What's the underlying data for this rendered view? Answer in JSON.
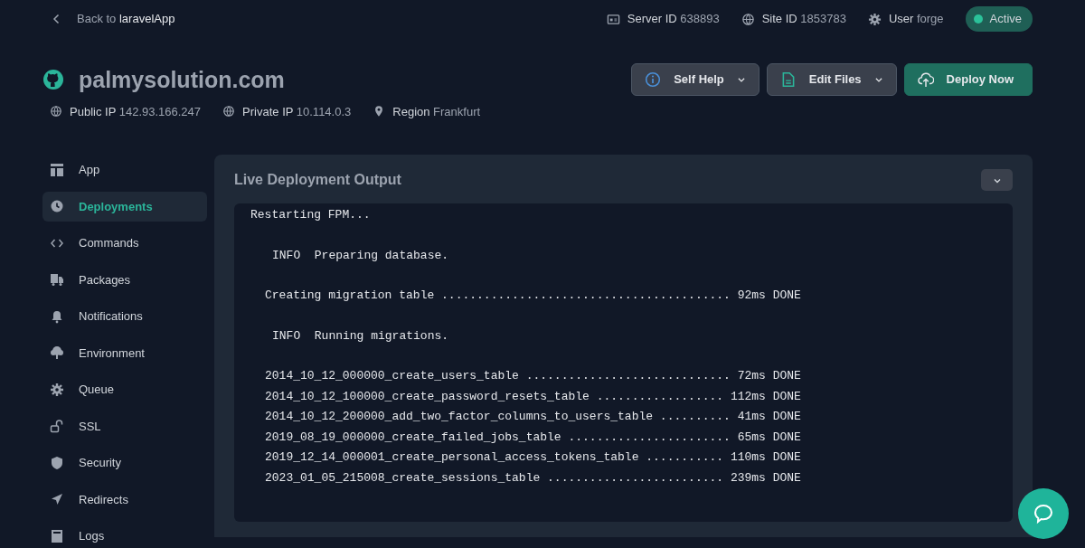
{
  "back": {
    "label": "Back to",
    "app": "laravelApp"
  },
  "meta": [
    {
      "kind": "server",
      "label": "Server ID",
      "value": "638893"
    },
    {
      "kind": "globe",
      "label": "Site ID",
      "value": "1853783"
    },
    {
      "kind": "gear",
      "label": "User",
      "value": "forge"
    }
  ],
  "status": {
    "label": "Active"
  },
  "site": {
    "title": "palmysolution.com"
  },
  "info": [
    {
      "kind": "globe",
      "label": "Public IP",
      "value": "142.93.166.247"
    },
    {
      "kind": "globe",
      "label": "Private IP",
      "value": "10.114.0.3"
    },
    {
      "kind": "pin",
      "label": "Region",
      "value": "Frankfurt"
    }
  ],
  "actions": [
    {
      "kind": "help",
      "label": "Self Help",
      "dropdown": true
    },
    {
      "kind": "files",
      "label": "Edit Files",
      "dropdown": true
    },
    {
      "kind": "deploy",
      "label": "Deploy Now",
      "dropdown": false
    }
  ],
  "sidebar": {
    "items": [
      {
        "kind": "layout",
        "label": "App",
        "selected": false
      },
      {
        "kind": "clock",
        "label": "Deployments",
        "selected": true
      },
      {
        "kind": "code",
        "label": "Commands",
        "selected": false
      },
      {
        "kind": "truck",
        "label": "Packages",
        "selected": false
      },
      {
        "kind": "bell",
        "label": "Notifications",
        "selected": false
      },
      {
        "kind": "tree",
        "label": "Environment",
        "selected": false
      },
      {
        "kind": "gear",
        "label": "Queue",
        "selected": false
      },
      {
        "kind": "lock",
        "label": "SSL",
        "selected": false
      },
      {
        "kind": "shield",
        "label": "Security",
        "selected": false
      },
      {
        "kind": "arrow",
        "label": "Redirects",
        "selected": false
      },
      {
        "kind": "logs",
        "label": "Logs",
        "selected": false
      }
    ]
  },
  "panel": {
    "title": "Live Deployment Output"
  },
  "output": {
    "blocks": [
      {
        "kind": "plain",
        "lines": [
          "Restarting FPM..."
        ]
      },
      {
        "kind": "info",
        "lines": [
          "INFO  Preparing database."
        ]
      },
      {
        "kind": "task",
        "lines": [
          "Creating migration table ......................................... 92ms DONE"
        ]
      },
      {
        "kind": "info",
        "lines": [
          "INFO  Running migrations."
        ]
      },
      {
        "kind": "task",
        "lines": [
          "2014_10_12_000000_create_users_table ............................. 72ms DONE",
          "2014_10_12_100000_create_password_resets_table .................. 112ms DONE",
          "2014_10_12_200000_add_two_factor_columns_to_users_table .......... 41ms DONE",
          "2019_08_19_000000_create_failed_jobs_table ....................... 65ms DONE",
          "2019_12_14_000001_create_personal_access_tokens_table ........... 110ms DONE",
          "2023_01_05_215008_create_sessions_table ......................... 239ms DONE"
        ]
      }
    ]
  }
}
